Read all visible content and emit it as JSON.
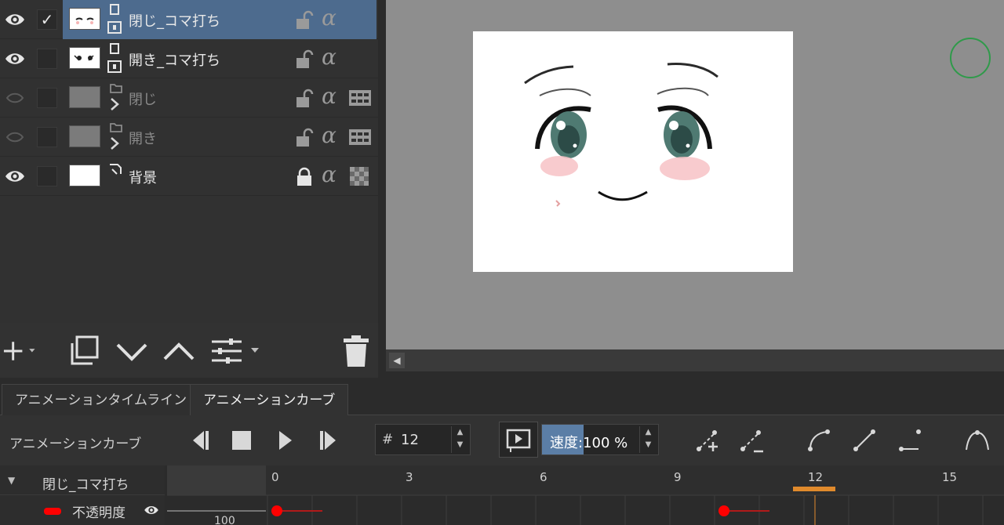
{
  "layers": [
    {
      "name": "閉じ_コマ打ち",
      "visible": true,
      "checked": true,
      "selected": true,
      "dimmed": false,
      "lock_icon": "unlock-icon",
      "extra_icon": ""
    },
    {
      "name": "開き_コマ打ち",
      "visible": true,
      "checked": false,
      "selected": false,
      "dimmed": false,
      "lock_icon": "unlock-icon",
      "extra_icon": ""
    },
    {
      "name": "閉じ",
      "visible": false,
      "checked": false,
      "selected": false,
      "dimmed": true,
      "lock_icon": "unlock-icon",
      "extra_icon": "filmstrip-icon"
    },
    {
      "name": "開き",
      "visible": false,
      "checked": false,
      "selected": false,
      "dimmed": true,
      "lock_icon": "unlock-icon",
      "extra_icon": "filmstrip-icon"
    },
    {
      "name": "背景",
      "visible": true,
      "checked": false,
      "selected": false,
      "dimmed": false,
      "lock_icon": "lock-icon",
      "extra_icon": "checker-icon"
    }
  ],
  "alpha_glyph": "α",
  "layer_toolbar": [
    "add-layer-icon",
    "duplicate-layer-icon",
    "move-down-icon",
    "move-up-icon",
    "layer-properties-icon",
    "delete-layer-icon"
  ],
  "tabs": [
    {
      "label": "アニメーションタイムライン",
      "active": false
    },
    {
      "label": "アニメーションカーブ",
      "active": true
    }
  ],
  "curve_toolbar": {
    "title": "アニメーションカーブ",
    "frame_prefix": "#",
    "frame_value": "12",
    "speed_label": "速度:100 %",
    "speed_percent": 100
  },
  "timeline": {
    "layer_name": "閉じ_コマ打ち",
    "channel_name": "不透明度",
    "channel_color": "#ff0000",
    "y_label": "100",
    "ruler_ticks": [
      "0",
      "3",
      "6",
      "9",
      "12",
      "15"
    ],
    "current_frame": 12,
    "keyframes": [
      1,
      11
    ]
  },
  "colors": {
    "selection": "#4d6b8e",
    "keyframe": "#ff0000",
    "playhead": "#e08a2c",
    "brush_cursor": "#2f9a4a"
  }
}
